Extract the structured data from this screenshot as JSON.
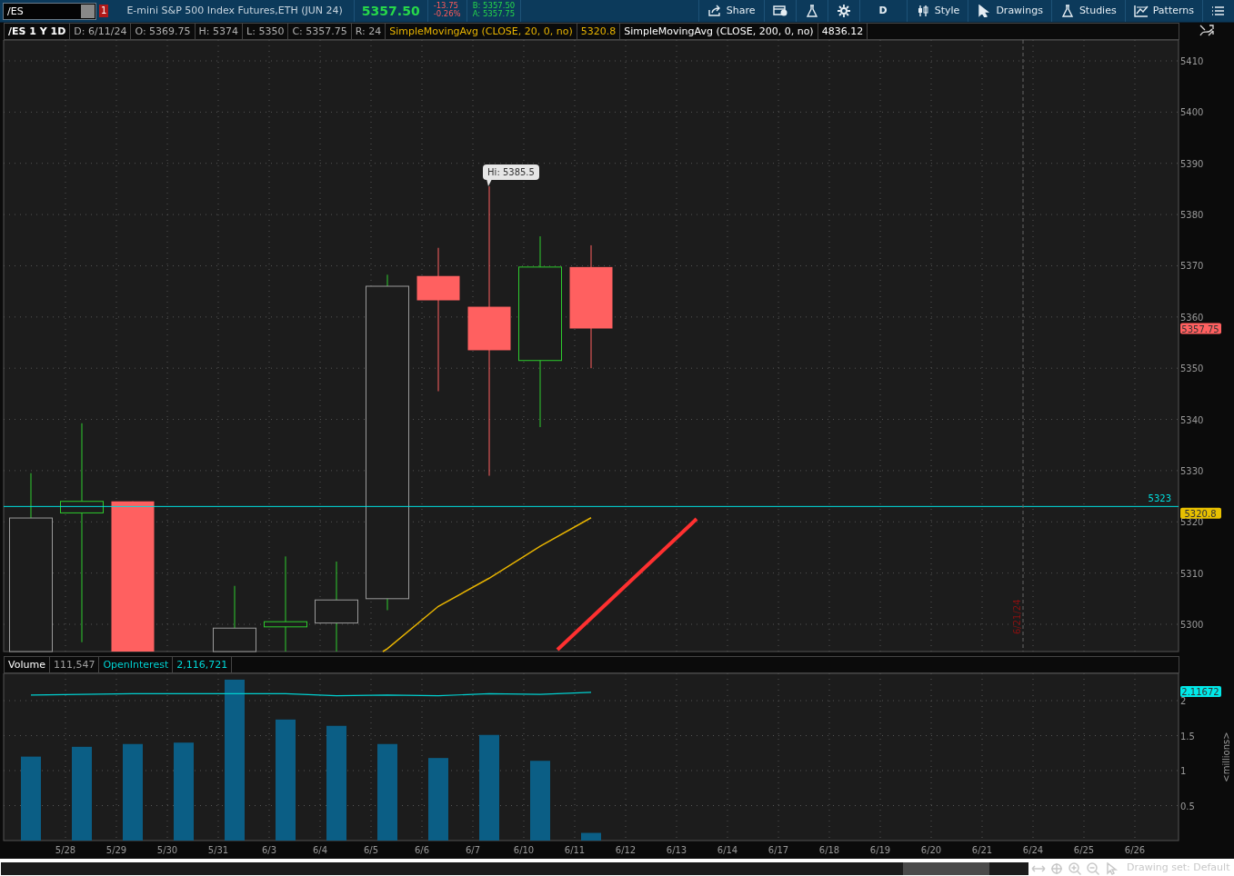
{
  "toolbar": {
    "symbol": "/ES",
    "link_number": "1",
    "description": "E-mini S&P 500 Index Futures,ETH (JUN 24)",
    "last_price": "5357.50",
    "change": "-13.75",
    "change_percent": "-0.26%",
    "bid": "B: 5357.50",
    "ask": "A: 5357.75",
    "buttons": [
      {
        "kind": "share",
        "label": "Share"
      },
      {
        "kind": "alert"
      },
      {
        "kind": "flask"
      },
      {
        "kind": "gear"
      },
      {
        "kind": "text",
        "label": "D"
      },
      {
        "kind": "style",
        "label": "Style"
      },
      {
        "kind": "drawings",
        "label": "Drawings"
      },
      {
        "kind": "studies",
        "label": "Studies"
      },
      {
        "kind": "patterns",
        "label": "Patterns"
      },
      {
        "kind": "menu"
      }
    ]
  },
  "price_panel": {
    "legend": [
      {
        "text": "/ES 1 Y 1D",
        "color": "#ffffff"
      },
      {
        "text": "D: 6/11/24",
        "color": "#b0b0b0"
      },
      {
        "text": "O: 5369.75",
        "color": "#b0b0b0"
      },
      {
        "text": "H: 5374",
        "color": "#b0b0b0"
      },
      {
        "text": "L: 5350",
        "color": "#b0b0b0"
      },
      {
        "text": "C: 5357.75",
        "color": "#b0b0b0"
      },
      {
        "text": "R: 24",
        "color": "#b0b0b0"
      },
      {
        "text": "SimpleMovingAvg (CLOSE, 20, 0, no)",
        "color": "#e8b400"
      },
      {
        "text": "5320.8",
        "color": "#e8b400"
      },
      {
        "text": "SimpleMovingAvg (CLOSE, 200, 0, no)",
        "color": "#ffffff"
      },
      {
        "text": "4836.12",
        "color": "#ffffff"
      }
    ],
    "price_axis": [
      "5410",
      "5400",
      "5390",
      "5380",
      "5370",
      "5360",
      "5350",
      "5340",
      "5330",
      "5320",
      "5310",
      "5300"
    ],
    "high_callout": "Hi: 5385.5",
    "level_label": "5323",
    "expiration_label": "6/21/24",
    "last_price_marker": "5357.75",
    "study_marker": "5320.8"
  },
  "volume_panel": {
    "legend": [
      {
        "text": "111,547",
        "color": "#a0a0a0"
      },
      {
        "text": "2,116,721",
        "color": "#00d8d8"
      }
    ],
    "chart_data": {
      "type": "bar",
      "categories": [
        null,
        "5/28",
        "5/29",
        "5/30",
        "5/31",
        "6/3",
        "6/4",
        "6/5",
        "6/6",
        "6/7",
        "6/10",
        "6/11",
        "6/12",
        "6/13",
        "6/14",
        "6/17",
        "6/18",
        "6/19",
        "6/20",
        "6/21",
        "6/24",
        "6/25",
        "6/26"
      ],
      "series": [
        {
          "name": "Volume",
          "color": "#0b5e85",
          "values": [
            1.2,
            1.34,
            1.38,
            1.4,
            2.3,
            1.73,
            1.64,
            1.38,
            1.18,
            1.51,
            1.14,
            0.11,
            null,
            null,
            null,
            null,
            null,
            null,
            null,
            null,
            null,
            null,
            null
          ]
        },
        {
          "name": "OpenInterest",
          "type": "line",
          "color": "#00d0d0",
          "values": [
            2.08,
            2.09,
            2.1,
            2.1,
            2.1,
            2.1,
            2.07,
            2.08,
            2.07,
            2.1,
            2.09,
            2.12,
            null,
            null,
            null,
            null,
            null,
            null,
            null,
            null,
            null,
            null,
            null
          ]
        }
      ],
      "grid": true,
      "ylabel": "<millions>",
      "ylim": [
        0,
        2.39
      ],
      "yticks": [
        0.5,
        1,
        1.5,
        2
      ]
    },
    "oi_marker": "2.11672"
  },
  "footer": {
    "drawing_set": "Drawing set: Default"
  }
}
